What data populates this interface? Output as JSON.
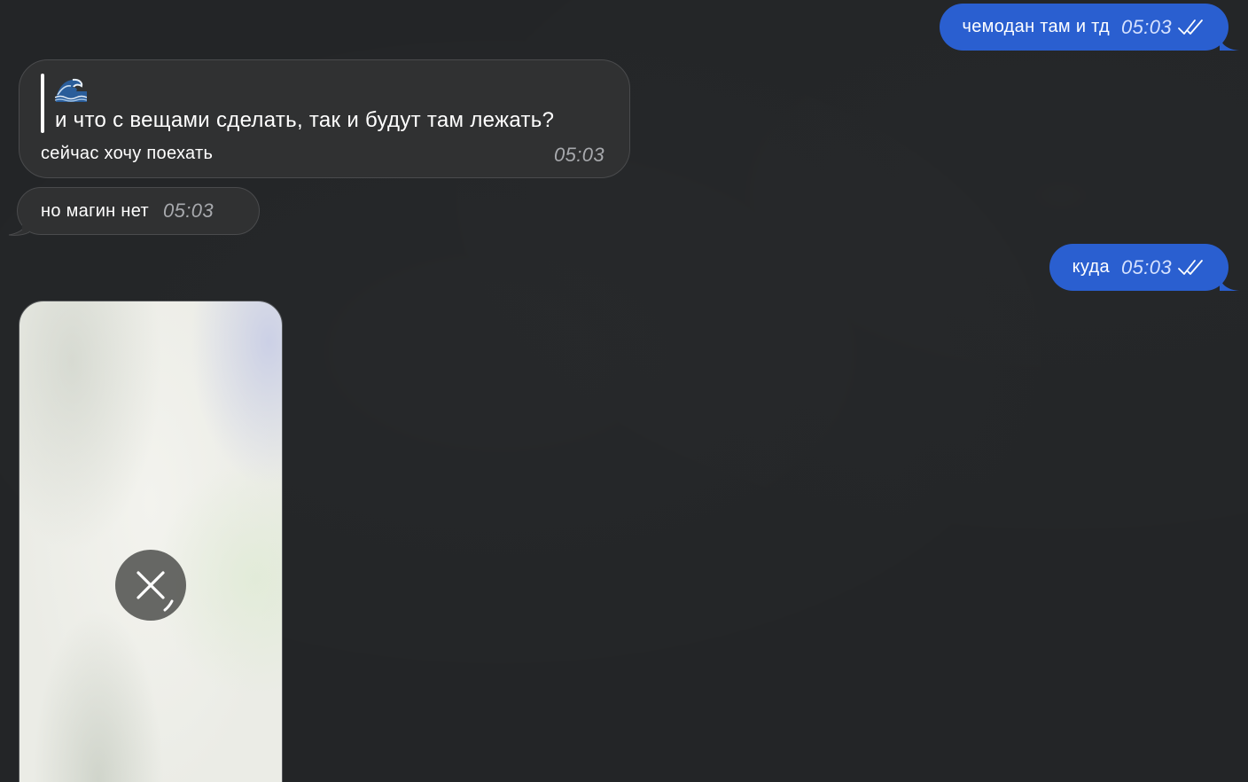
{
  "messages": [
    {
      "id": "m1",
      "direction": "outgoing",
      "text": "чемодан там и тд",
      "time": "05:03",
      "status": "read",
      "status_icon": "double-check-icon"
    },
    {
      "id": "m2",
      "direction": "incoming",
      "reply_to": {
        "emoji": "🌊",
        "emoji_icon": "wave-emoji-icon",
        "text": "и что с вещами сделать, так и будут там лежать?"
      },
      "text": "сейчас хочу поехать",
      "time": "05:03"
    },
    {
      "id": "m3",
      "direction": "incoming",
      "text": "но магин нет",
      "time": "05:03"
    },
    {
      "id": "m4",
      "direction": "outgoing",
      "text": "куда",
      "time": "05:03",
      "status": "read",
      "status_icon": "double-check-icon"
    },
    {
      "id": "m5",
      "direction": "incoming",
      "type": "photo",
      "state": "loading",
      "action_icon": "cancel-download-icon"
    }
  ],
  "colors": {
    "background": "#232527",
    "outgoing_bubble": "#2a5fd0",
    "incoming_bubble": "#303132",
    "incoming_border": "#4a4b4d",
    "time_outgoing": "#d6e2ff",
    "time_incoming": "#a7a9ad"
  }
}
